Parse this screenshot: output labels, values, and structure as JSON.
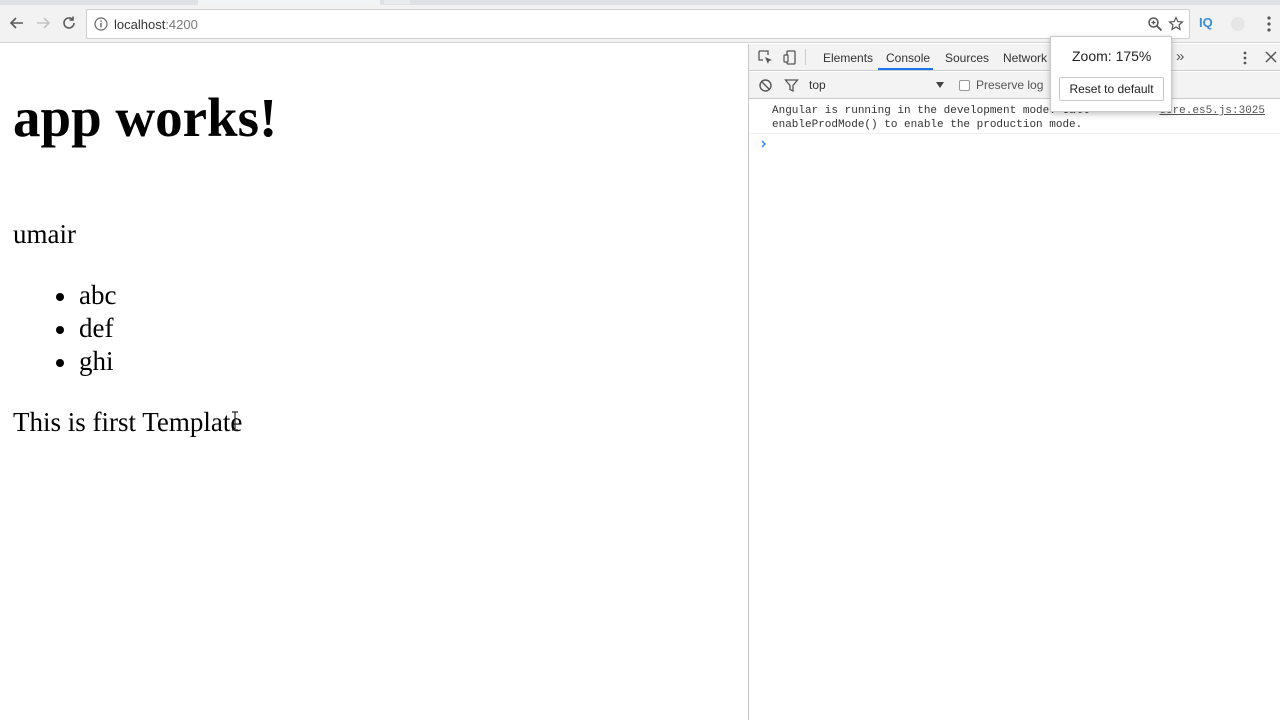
{
  "browser": {
    "url_host": "localhost",
    "url_port": ":4200"
  },
  "page": {
    "heading": "app works!",
    "name": "umair",
    "list_items": [
      "abc",
      "def",
      "ghi"
    ],
    "template_text": "This is first Template"
  },
  "devtools": {
    "tabs": [
      "Elements",
      "Console",
      "Sources",
      "Network"
    ],
    "active_tab": "Console",
    "more_label": "»",
    "context": "top",
    "preserve_log_label": "Preserve log",
    "console_message_line1": "Angular is running in the development mode. Call",
    "console_message_line2": "enableProdMode() to enable the production mode.",
    "console_message_source": "core.es5.js:3025"
  },
  "zoom_popup": {
    "label": "Zoom: 175%",
    "reset_label": "Reset to default"
  },
  "extension": {
    "iq_label": "IQ"
  },
  "colors": {
    "accent": "#1a73e8",
    "extension_blue": "#3b8fd6"
  }
}
